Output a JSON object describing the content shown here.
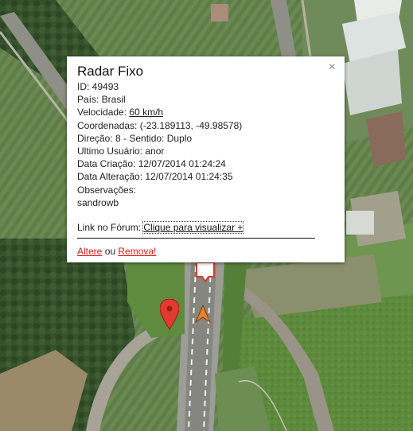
{
  "popup": {
    "title": "Radar Fixo",
    "close_icon": "×",
    "id": "ID: 49493",
    "pais": "País: Brasil",
    "velocidade_label": "Velocidade: ",
    "velocidade_value": "60 km/h",
    "coordenadas": "Coordenadas: (-23.189113, -49.98578)",
    "direcao": "Direção: 8 - Sentido: Duplo",
    "ultimo_usuario": "Ultimo Usuário: anor",
    "data_criacao": "Data Criação: 12/07/2014 01:24:24",
    "data_alteracao": "Data Alteração: 12/07/2014 01:24:35",
    "observacoes_label": "Observações:",
    "observacoes_value": "sandrowb",
    "forum_label": "Link no Fórum: ",
    "forum_link": "Clique para visualizar +",
    "altere_link": "Altere",
    "ou": " ou ",
    "remova_link": "Remova!"
  },
  "map": {
    "markers": [
      "map-pin-icon",
      "navigation-arrow-icon",
      "speed-camera-marker-icon"
    ],
    "colors": {
      "pin": "#e23a2e",
      "arrow": "#e8812a",
      "link": "#e01b1b"
    }
  }
}
